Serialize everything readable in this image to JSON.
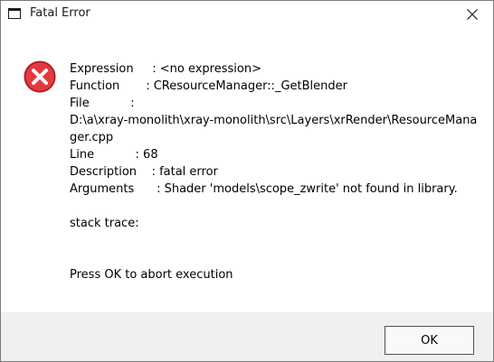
{
  "window": {
    "title": "Fatal Error"
  },
  "icons": {
    "app": "window-icon",
    "error": "error-icon",
    "close": "close-icon"
  },
  "colors": {
    "error_red": "#d9262b",
    "footer_bg": "#f0f0f0"
  },
  "message": {
    "lines": [
      "Expression     : <no expression>",
      "Function       : CResourceManager::_GetBlender",
      "File           :",
      "D:\\a\\xray-monolith\\xray-monolith\\src\\Layers\\xrRender\\ResourceMana",
      "ger.cpp",
      "Line           : 68",
      "Description    : fatal error",
      "Arguments      : Shader 'models\\scope_zwrite' not found in library.",
      "",
      "stack trace:",
      "",
      "",
      "Press OK to abort execution"
    ]
  },
  "buttons": {
    "ok_label": "OK"
  }
}
